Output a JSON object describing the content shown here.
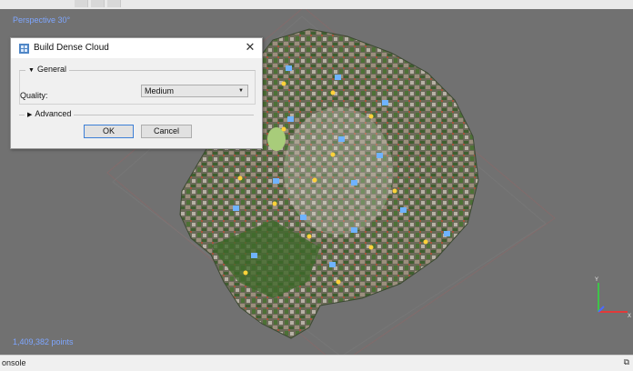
{
  "viewport": {
    "mode_label": "Perspective 30°",
    "points_label": "1,409,382 points"
  },
  "dialog": {
    "title": "Build Dense Cloud",
    "general_label": "General",
    "quality_label": "Quality:",
    "quality_value": "Medium",
    "advanced_label": "Advanced",
    "ok_label": "OK",
    "cancel_label": "Cancel"
  },
  "statusbar": {
    "console_label": "onsole"
  },
  "icons": {
    "dialog": "dense-cloud-icon",
    "close": "close-icon",
    "expanded": "triangle-down-icon",
    "collapsed": "triangle-right-icon",
    "dropdown": "chevron-down-icon",
    "dock": "dock-icon"
  },
  "colors": {
    "viewport_bg": "#717171",
    "overlay_text": "#7ea6ff",
    "camera_marker": "#6fb3ff",
    "gcp_marker": "#ffd23a"
  }
}
